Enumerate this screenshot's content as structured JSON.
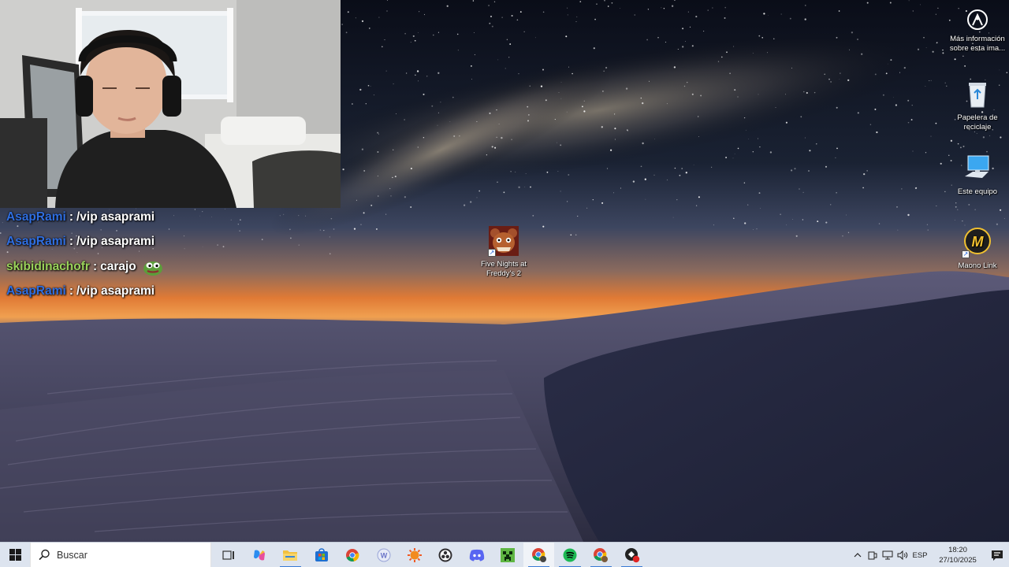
{
  "chat": {
    "lines": [
      {
        "user": "AsapRami",
        "user_color": "#2f6ee0",
        "separator": ":",
        "message": "/vip asaprami"
      },
      {
        "user": "AsapRami",
        "user_color": "#2f6ee0",
        "separator": ":",
        "message": "/vip asaprami"
      },
      {
        "user": "skibidinachofr",
        "user_color": "#9ad35a",
        "separator": ":",
        "message": "carajo",
        "emote": "pepe-emote"
      },
      {
        "user": "AsapRami",
        "user_color": "#2f6ee0",
        "separator": ":",
        "message": "/vip asaprami"
      }
    ]
  },
  "desktop": {
    "icons": [
      {
        "name": "more-info-icon",
        "label": "Más información sobre esta ima..."
      },
      {
        "name": "recycle-bin-icon",
        "label": "Papelera de reciclaje"
      },
      {
        "name": "this-pc-icon",
        "label": "Este equipo"
      },
      {
        "name": "maono-link-icon",
        "label": "Maono Link"
      },
      {
        "name": "fnaf2-icon",
        "label": "Five Nights at Freddy's 2"
      }
    ]
  },
  "taskbar": {
    "search_placeholder": "Buscar",
    "apps": [
      "task-view-icon",
      "copilot-icon",
      "file-explorer-icon",
      "microsoft-store-icon",
      "chrome-icon",
      "app-w-icon",
      "sun-app-icon",
      "obs-icon",
      "discord-icon",
      "minecraft-icon",
      "chrome-profile-icon",
      "spotify-icon",
      "chrome-profile-2-icon",
      "red-app-icon"
    ],
    "language": "ESP",
    "time": "18:20",
    "date": "27/10/2025"
  },
  "colors": {
    "taskbar_bg": "#dde4ef",
    "accent": "#3a7bd5"
  }
}
